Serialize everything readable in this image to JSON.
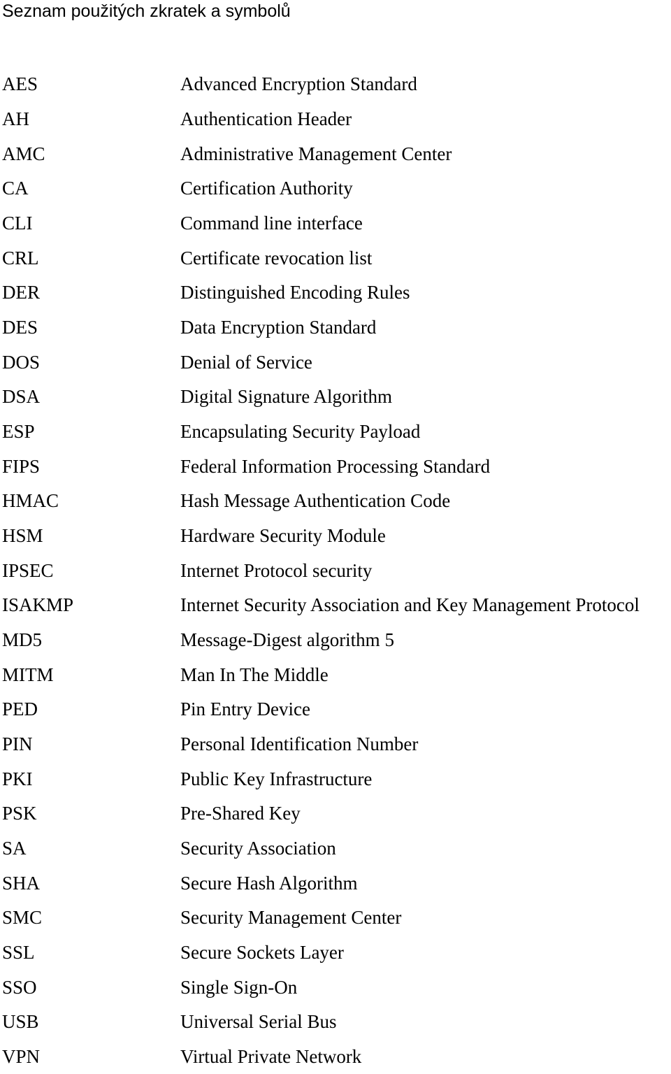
{
  "title": "Seznam použitých zkratek a symbolů",
  "entries": [
    {
      "abbr": "AES",
      "def": "Advanced Encryption Standard"
    },
    {
      "abbr": "AH",
      "def": "Authentication Header"
    },
    {
      "abbr": "AMC",
      "def": "Administrative Management Center"
    },
    {
      "abbr": "CA",
      "def": "Certification Authority"
    },
    {
      "abbr": "CLI",
      "def": "Command line interface"
    },
    {
      "abbr": "CRL",
      "def": "Certificate revocation list"
    },
    {
      "abbr": "DER",
      "def": "Distinguished Encoding Rules"
    },
    {
      "abbr": "DES",
      "def": "Data Encryption Standard"
    },
    {
      "abbr": "DOS",
      "def": "Denial of Service"
    },
    {
      "abbr": "DSA",
      "def": "Digital Signature Algorithm"
    },
    {
      "abbr": "ESP",
      "def": "Encapsulating Security Payload"
    },
    {
      "abbr": "FIPS",
      "def": "Federal Information Processing Standard"
    },
    {
      "abbr": "HMAC",
      "def": "Hash Message Authentication Code"
    },
    {
      "abbr": "HSM",
      "def": "Hardware Security Module"
    },
    {
      "abbr": "IPSEC",
      "def": "Internet Protocol security"
    },
    {
      "abbr": "ISAKMP",
      "def": "Internet Security Association and Key Management Protocol"
    },
    {
      "abbr": "MD5",
      "def": "Message-Digest algorithm 5"
    },
    {
      "abbr": "MITM",
      "def": "Man In The Middle"
    },
    {
      "abbr": "PED",
      "def": "Pin Entry Device"
    },
    {
      "abbr": "PIN",
      "def": "Personal Identification Number"
    },
    {
      "abbr": "PKI",
      "def": "Public Key Infrastructure"
    },
    {
      "abbr": "PSK",
      "def": "Pre-Shared Key"
    },
    {
      "abbr": "SA",
      "def": "Security Association"
    },
    {
      "abbr": "SHA",
      "def": "Secure Hash Algorithm"
    },
    {
      "abbr": "SMC",
      "def": "Security Management Center"
    },
    {
      "abbr": "SSL",
      "def": "Secure Sockets Layer"
    },
    {
      "abbr": "SSO",
      "def": "Single Sign-On"
    },
    {
      "abbr": "USB",
      "def": "Universal Serial Bus"
    },
    {
      "abbr": "VPN",
      "def": "Virtual Private Network"
    }
  ]
}
